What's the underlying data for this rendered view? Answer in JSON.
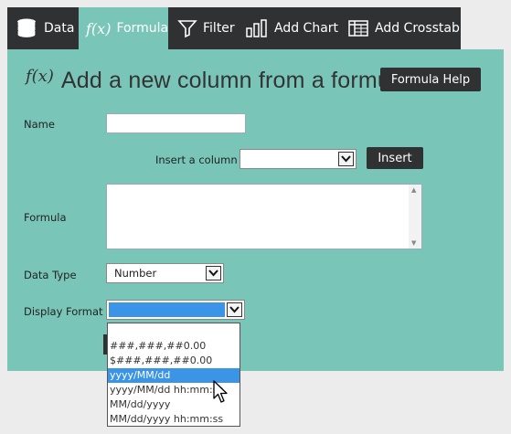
{
  "tabs": [
    {
      "label": "Data",
      "icon": "database-icon"
    },
    {
      "label": "Formula",
      "icon": "fx-icon",
      "icon_text": "f(x)",
      "active": true
    },
    {
      "label": "Filter",
      "icon": "funnel-icon"
    },
    {
      "label": "Add Chart",
      "icon": "bar-chart-icon"
    },
    {
      "label": "Add Crosstab",
      "icon": "grid-table-icon"
    }
  ],
  "panel": {
    "fx": "f(x)",
    "title": "Add a new column from a formula.",
    "help_button": "Formula Help"
  },
  "form": {
    "name_label": "Name",
    "name_value": "",
    "insert_column_label": "Insert a column",
    "insert_column_value": "",
    "insert_button": "Insert",
    "formula_label": "Formula",
    "formula_value": "",
    "data_type_label": "Data Type",
    "data_type_value": "Number",
    "display_format_label": "Display Format",
    "display_format_value": ""
  },
  "format_options": [
    "",
    "###,###,##0.00",
    "$###,###,##0.00",
    "yyyy/MM/dd",
    "yyyy/MM/dd hh:mm:ss",
    "MM/dd/yyyy",
    "MM/dd/yyyy hh:mm:ss"
  ],
  "format_selected_index": 3,
  "colors": {
    "tab_bar": "#2f3133",
    "active_tab": "#79c6b9",
    "panel": "#79c6b9",
    "selection": "#3b94e6"
  }
}
